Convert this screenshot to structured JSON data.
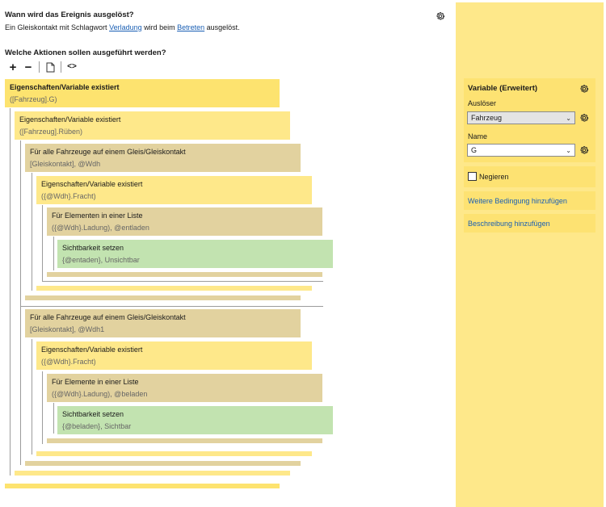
{
  "header": {
    "trigger_question": "Wann wird das Ereignis ausgelöst?",
    "trigger_sentence_pre": "Ein Gleiskontakt mit Schlagwort ",
    "trigger_link_keyword": "Verladung",
    "trigger_sentence_mid": " wird beim ",
    "trigger_link_event": "Betreten",
    "trigger_sentence_post": " ausgelöst.",
    "actions_question": "Welche Aktionen sollen ausgeführt werden?"
  },
  "toolbar": {
    "add_label": "+",
    "remove_label": "−",
    "code_label": "<>"
  },
  "tree": [
    {
      "title": "Eigenschaften/Variable existiert",
      "sub": "([Fahrzeug].G)"
    },
    {
      "title": "Eigenschaften/Variable existiert",
      "sub": "([Fahrzeug].Rüben)"
    },
    {
      "title": "Für alle Fahrzeuge auf einem Gleis/Gleiskontakt",
      "sub": "[Gleiskontakt], @Wdh"
    },
    {
      "title": "Eigenschaften/Variable existiert",
      "sub": "({@Wdh}.Fracht)"
    },
    {
      "title": "Für Elementen in einer Liste",
      "sub": "({@Wdh}.Ladung), @entladen"
    },
    {
      "title": "Sichtbarkeit setzen",
      "sub": "{@entaden}, Unsichtbar"
    },
    {
      "title": "Für alle Fahrzeuge auf einem Gleis/Gleiskontakt",
      "sub": "[Gleiskontakt], @Wdh1"
    },
    {
      "title": "Eigenschaften/Variable existiert",
      "sub": "({@Wdh}.Fracht)"
    },
    {
      "title": "Für Elemente in einer Liste",
      "sub": "({@Wdh}.Ladung), @beladen"
    },
    {
      "title": "Sichtbarkeit setzen",
      "sub": "{@beladen}, Sichtbar"
    }
  ],
  "panel": {
    "title": "Variable (Erweitert)",
    "trigger_label": "Auslöser",
    "trigger_value": "Fahrzeug",
    "name_label": "Name",
    "name_value": "G",
    "negate_label": "Negieren",
    "add_condition_link": "Weitere Bedingung hinzufügen",
    "add_description_link": "Beschreibung hinzufügen"
  },
  "colors": {
    "panel_bg": "#fee88a",
    "condition_block": "#fee88a",
    "loop_block": "#e2d29f",
    "action_block": "#c2e3b0",
    "link": "#1a5fb4"
  },
  "icons": {
    "settings": "gear-icon",
    "copy": "document-copy-icon",
    "dropdown": "chevron-down-icon"
  }
}
